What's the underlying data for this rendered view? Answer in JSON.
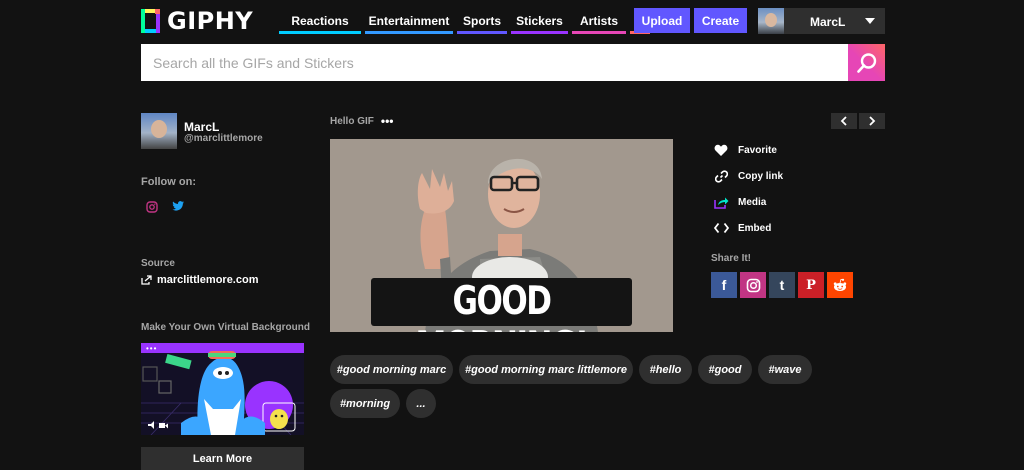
{
  "header": {
    "logo_text": "GIPHY",
    "nav": [
      {
        "label": "Reactions",
        "color": "#00ccff"
      },
      {
        "label": "Entertainment",
        "color": "#3399ff"
      },
      {
        "label": "Sports",
        "color": "#6157ff"
      },
      {
        "label": "Stickers",
        "color": "#9933ff"
      },
      {
        "label": "Artists",
        "color": "#e646b6"
      }
    ],
    "more_label": "⋮",
    "more_color": "#ff6666",
    "upload_label": "Upload",
    "create_label": "Create",
    "user_name": "MarcL"
  },
  "search": {
    "placeholder": "Search all the GIFs and Stickers",
    "value": ""
  },
  "profile": {
    "name": "MarcL",
    "handle": "@marclittlemore",
    "follow_label": "Follow on:",
    "social": [
      "instagram-icon",
      "twitter-icon"
    ]
  },
  "source": {
    "label": "Source",
    "link": "marclittlemore.com"
  },
  "virtual_background": {
    "label": "Make Your Own Virtual Background",
    "dots": "•••",
    "button": "Learn More"
  },
  "gif": {
    "title": "Hello GIF",
    "menu": "•••",
    "caption": "GOOD MORNING!",
    "tags": [
      "#good morning marc",
      "#good morning marc littlemore",
      "#hello",
      "#good",
      "#wave",
      "#morning",
      "..."
    ]
  },
  "actions": [
    {
      "label": "Favorite",
      "icon": "heart-icon"
    },
    {
      "label": "Copy link",
      "icon": "link-icon"
    },
    {
      "label": "Media",
      "icon": "media-icon"
    },
    {
      "label": "Embed",
      "icon": "embed-icon"
    }
  ],
  "share": {
    "label": "Share It!",
    "buttons": [
      {
        "icon": "facebook-icon",
        "glyph": "f",
        "color": "#3b5998"
      },
      {
        "icon": "instagram-icon",
        "glyph": "",
        "color": "#c13584"
      },
      {
        "icon": "tumblr-icon",
        "glyph": "t",
        "color": "#35465c"
      },
      {
        "icon": "pinterest-icon",
        "glyph": "P",
        "color": "#cb2027"
      },
      {
        "icon": "reddit-icon",
        "glyph": "",
        "color": "#ff4500"
      }
    ]
  }
}
